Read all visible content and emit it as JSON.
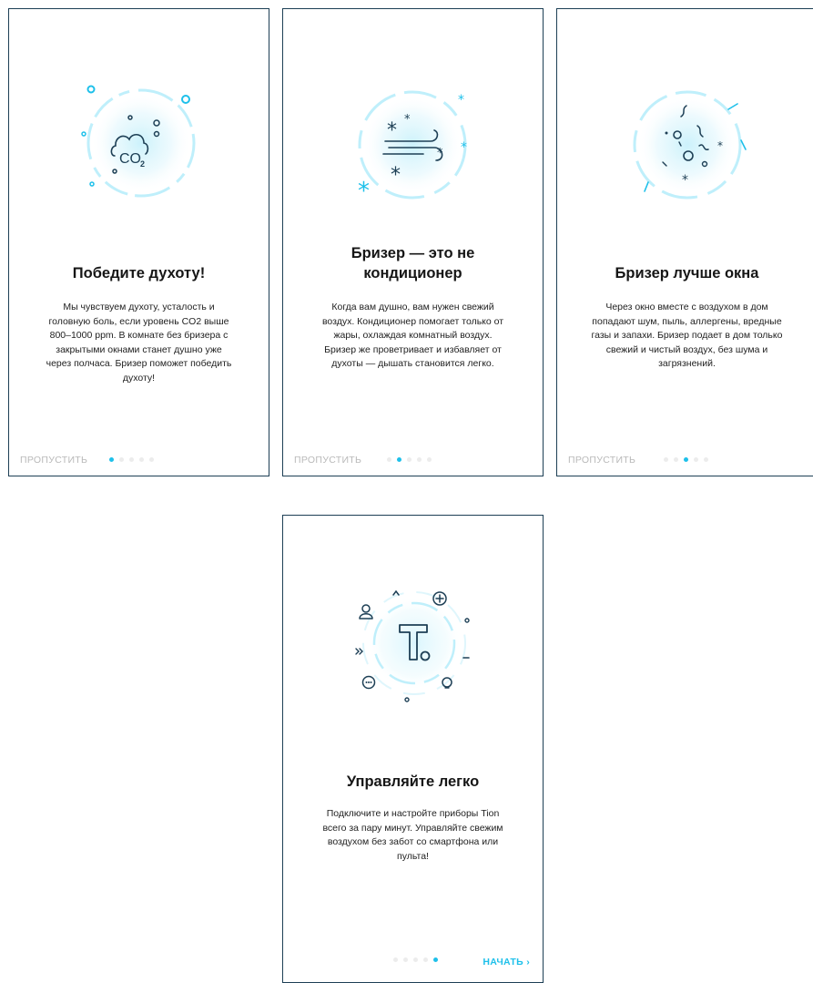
{
  "colors": {
    "accent": "#1ec0ea",
    "frame": "#1d3f55",
    "dot_inactive": "#ececec",
    "skip_text": "#b9b9b9"
  },
  "screens": [
    {
      "title": "Победите духоту!",
      "description": "Мы чувствуем духоту, усталость и\nголовную боль, если уровень CO2 выше\n800–1000 ppm. В комнате без бризера с\nзакрытыми окнами станет душно уже\nчерез полчаса. Бризер поможет победить\nдухоту!",
      "skip_label": "ПРОПУСТИТЬ",
      "active_dot": 1,
      "icon": "cloud-co2-icon",
      "icon_text": "CO",
      "icon_subscript": "2"
    },
    {
      "title": "Бризер — это не\nкондиционер",
      "description": "Когда вам душно, вам нужен свежий\nвоздух. Кондиционер помогает только от\nжары, охлаждая комнатный воздух.\nБризер же проветривает и избавляет от\nдухоты — дышать становится легко.",
      "skip_label": "ПРОПУСТИТЬ",
      "active_dot": 2,
      "icon": "wind-snowflake-icon"
    },
    {
      "title": "Бризер лучше окна",
      "description": "Через окно вместе с воздухом в дом\nпопадают шум, пыль, аллергены, вредные\nгазы и запахи. Бризер подает в дом только\nсвежий и чистый воздух, без шума и\nзагрязнений.",
      "skip_label": "ПРОПУСТИТЬ",
      "active_dot": 3,
      "icon": "particles-icon"
    },
    {
      "title": "Управляйте легко",
      "description": "Подключите и настройте приборы Tion\nвсего за пару минут. Управляйте свежим\nвоздухом без забот со смартфона или\nпульта!",
      "start_label": "НАЧАТЬ",
      "active_dot": 5,
      "icon": "tion-logo-icon"
    }
  ],
  "dots_total": 5
}
